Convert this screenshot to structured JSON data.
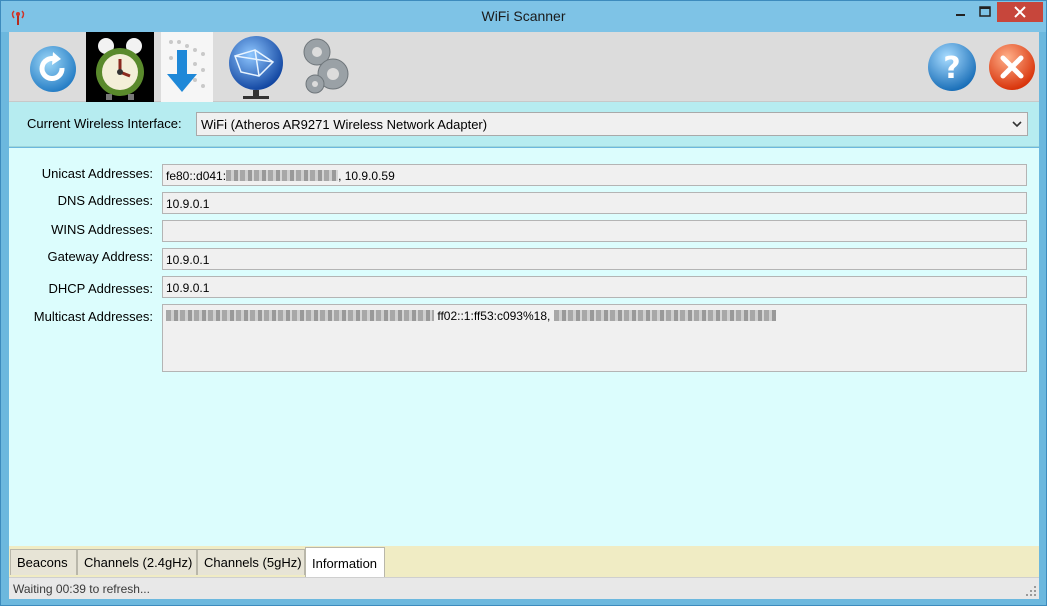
{
  "window": {
    "title": "WiFi Scanner",
    "app_icon": "antenna-icon"
  },
  "toolbar": {
    "buttons": [
      {
        "name": "refresh",
        "icon": "refresh-icon"
      },
      {
        "name": "alarm-clock",
        "icon": "alarm-clock-icon"
      },
      {
        "name": "download",
        "icon": "download-icon"
      },
      {
        "name": "network",
        "icon": "globe-network-icon"
      },
      {
        "name": "settings",
        "icon": "gears-icon"
      },
      {
        "name": "help",
        "icon": "help-icon"
      },
      {
        "name": "exit",
        "icon": "close-icon"
      }
    ]
  },
  "interface": {
    "label": "Current Wireless Interface:",
    "selected": "WiFi (Atheros AR9271 Wireless Network Adapter)"
  },
  "info": {
    "unicast_label": "Unicast Addresses:",
    "unicast_prefix": "fe80::d041:",
    "unicast_suffix": ", 10.9.0.59",
    "dns_label": "DNS Addresses:",
    "dns_value": "10.9.0.1",
    "wins_label": "WINS Addresses:",
    "wins_value": "",
    "gateway_label": "Gateway Address:",
    "gateway_value": "10.9.0.1",
    "dhcp_label": "DHCP Addresses:",
    "dhcp_value": "10.9.0.1",
    "multicast_label": "Multicast Addresses:",
    "multicast_middle": "ff02::1:ff53:c093%18, "
  },
  "tabs": [
    "Beacons",
    "Channels (2.4gHz)",
    "Channels (5gHz)",
    "Information"
  ],
  "active_tab": "Information",
  "status": "Waiting 00:39 to refresh...",
  "colors": {
    "titlebar": "#7ec3e6",
    "interface_bar": "#b6ecf0",
    "content_bg": "#dcfdfd",
    "tabbar_bg": "#f0ecc4"
  }
}
